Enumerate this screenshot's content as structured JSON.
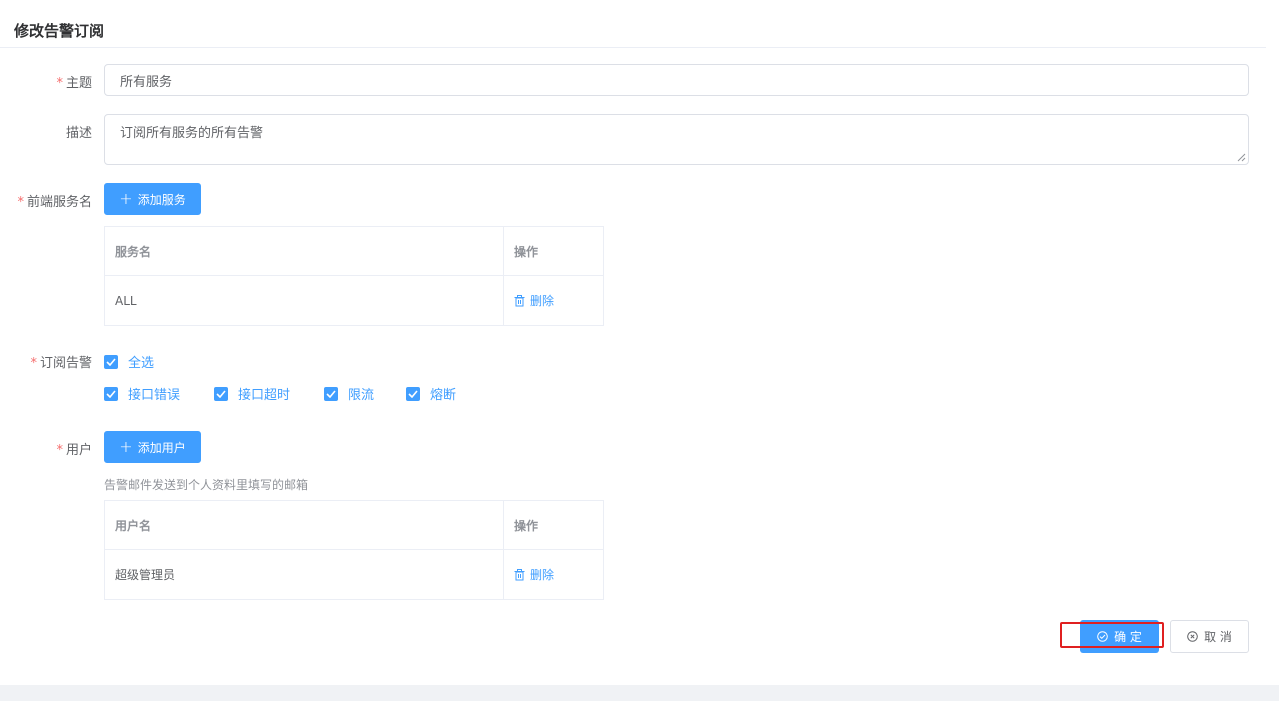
{
  "header": {
    "title": "修改告警订阅"
  },
  "form": {
    "required_mark": "*",
    "subject": {
      "label": "主题",
      "value": "所有服务"
    },
    "description": {
      "label": "描述",
      "value": "订阅所有服务的所有告警"
    },
    "frontend_service": {
      "label": "前端服务名",
      "add_button": "添加服务",
      "table": {
        "headers": [
          "服务名",
          "操作"
        ],
        "rows": [
          {
            "name": "ALL",
            "action": "删除"
          }
        ]
      }
    },
    "subscribe_alerts": {
      "label": "订阅告警",
      "select_all": "全选",
      "options": [
        "接口错误",
        "接口超时",
        "限流",
        "熔断"
      ]
    },
    "users": {
      "label": "用户",
      "add_button": "添加用户",
      "hint": "告警邮件发送到个人资料里填写的邮箱",
      "table": {
        "headers": [
          "用户名",
          "操作"
        ],
        "rows": [
          {
            "name": "超级管理员",
            "action": "删除"
          }
        ]
      }
    }
  },
  "actions": {
    "confirm": "确 定",
    "cancel": "取 消"
  },
  "colors": {
    "primary": "#409eff",
    "required": "#f56c6c",
    "highlight": "#e02020"
  }
}
